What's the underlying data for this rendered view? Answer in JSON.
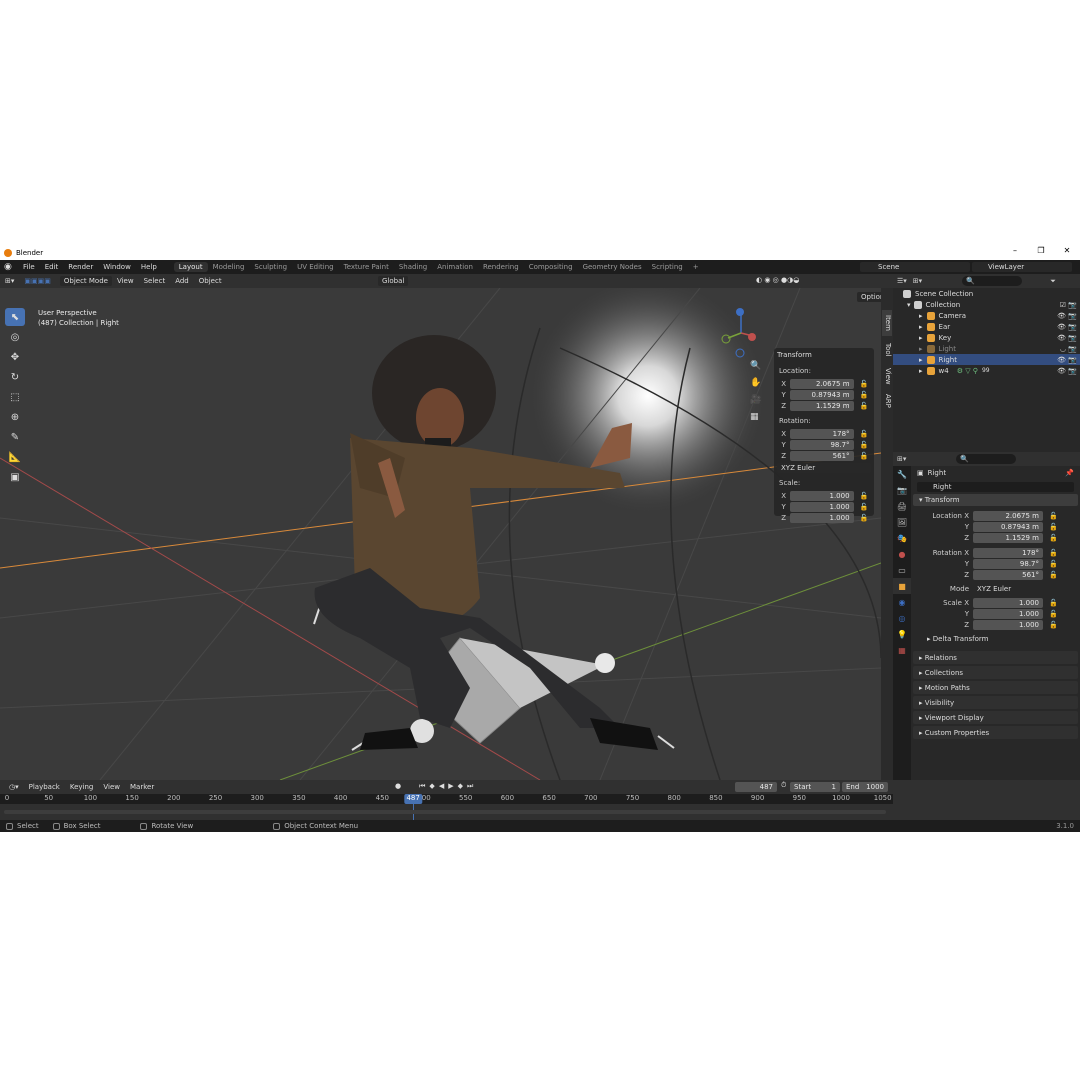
{
  "window": {
    "title": "Blender"
  },
  "menu": [
    "File",
    "Edit",
    "Render",
    "Window",
    "Help"
  ],
  "workspaces": [
    "Layout",
    "Modeling",
    "Sculpting",
    "UV Editing",
    "Texture Paint",
    "Shading",
    "Animation",
    "Rendering",
    "Compositing",
    "Geometry Nodes",
    "Scripting"
  ],
  "workspace_add": "+",
  "scene_label": "Scene",
  "view_layer_label": "ViewLayer",
  "viewport_header": {
    "mode": "Object Mode",
    "view": "View",
    "select": "Select",
    "add": "Add",
    "object": "Object",
    "orientation": "Global",
    "options": "Options"
  },
  "viewport": {
    "perspective": "User Perspective",
    "context": "(487) Collection | Right"
  },
  "npanel": {
    "title": "Transform",
    "location_label": "Location:",
    "location": [
      {
        "ax": "X",
        "v": "2.0675 m"
      },
      {
        "ax": "Y",
        "v": "0.87943 m"
      },
      {
        "ax": "Z",
        "v": "1.1529 m"
      }
    ],
    "rotation_label": "Rotation:",
    "rotation": [
      {
        "ax": "X",
        "v": "178°"
      },
      {
        "ax": "Y",
        "v": "98.7°"
      },
      {
        "ax": "Z",
        "v": "561°"
      }
    ],
    "rotation_mode": "XYZ Euler",
    "scale_label": "Scale:",
    "scale": [
      {
        "ax": "X",
        "v": "1.000"
      },
      {
        "ax": "Y",
        "v": "1.000"
      },
      {
        "ax": "Z",
        "v": "1.000"
      }
    ]
  },
  "side_tabs": [
    "Item",
    "Tool",
    "View",
    "ARP"
  ],
  "outliner": {
    "scene_collection": "Scene Collection",
    "collection": "Collection",
    "items": [
      {
        "name": "Camera",
        "color": "#e8a33a",
        "selected": false
      },
      {
        "name": "Ear",
        "color": "#e8a33a",
        "selected": false
      },
      {
        "name": "Key",
        "color": "#e8a33a",
        "selected": false
      },
      {
        "name": "Light",
        "color": "#e8a33a",
        "selected": false
      },
      {
        "name": "Right",
        "color": "#e8a33a",
        "selected": true
      },
      {
        "name": "w4",
        "color": "#e8a33a",
        "selected": false
      }
    ],
    "w4_count": "99"
  },
  "properties": {
    "object_name": "Right",
    "name_field": "Right",
    "transform_title": "Transform",
    "location_x_label": "Location X",
    "rotation_x_label": "Rotation X",
    "y_label": "Y",
    "z_label": "Z",
    "location": [
      "2.0675 m",
      "0.87943 m",
      "1.1529 m"
    ],
    "rotation": [
      "178°",
      "98.7°",
      "561°"
    ],
    "mode_label": "Mode",
    "mode": "XYZ Euler",
    "scale_x_label": "Scale X",
    "scale": [
      "1.000",
      "1.000",
      "1.000"
    ],
    "delta": "Delta Transform",
    "sections": [
      "Relations",
      "Collections",
      "Motion Paths",
      "Visibility",
      "Viewport Display",
      "Custom Properties"
    ]
  },
  "timeline": {
    "playback": "Playback",
    "keying": "Keying",
    "view": "View",
    "marker": "Marker",
    "current_frame": "487",
    "start_label": "Start",
    "start": "1",
    "end_label": "End",
    "end": "1000",
    "ticks": [
      "0",
      "50",
      "100",
      "150",
      "200",
      "250",
      "300",
      "350",
      "400",
      "450",
      "500",
      "550",
      "600",
      "650",
      "700",
      "750",
      "800",
      "850",
      "900",
      "950",
      "1000",
      "1050"
    ]
  },
  "status": {
    "select": "Select",
    "box_select": "Box Select",
    "rotate_view": "Rotate View",
    "context_menu": "Object Context Menu",
    "version": "3.1.0"
  },
  "colors": {
    "accent": "#4772b3",
    "selected_row": "#334d80",
    "x_axis": "#c0504d",
    "y_axis": "#7aa33a",
    "z_axis": "#3d6fc4"
  }
}
